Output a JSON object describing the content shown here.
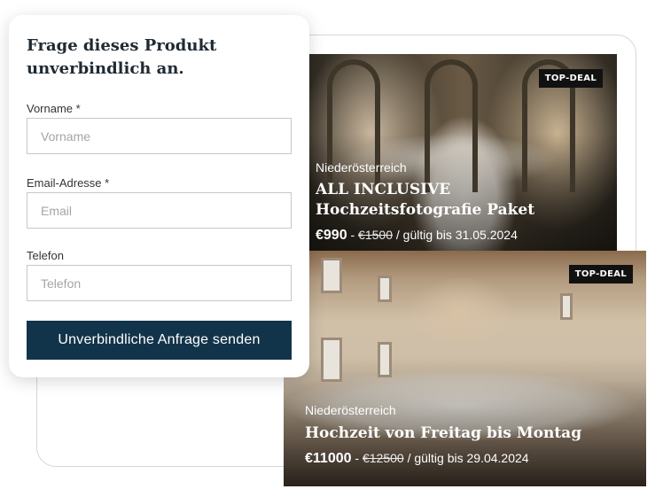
{
  "form": {
    "title": "Frage dieses Produkt unverbindlich an.",
    "fields": [
      {
        "label": "Vorname *",
        "placeholder": "Vorname",
        "value": ""
      },
      {
        "label": "Email-Adresse *",
        "placeholder": "Email",
        "value": ""
      },
      {
        "label": "Telefon",
        "placeholder": "Telefon",
        "value": ""
      }
    ],
    "submit_label": "Unverbindliche Anfrage senden"
  },
  "deals": [
    {
      "badge": "TOP-DEAL",
      "region": "Niederösterreich",
      "title": "ALL INCLUSIVE Hochzeitsfotografie Paket",
      "price": "€990",
      "separator": "-",
      "old_price": "€1500",
      "validity": "/ gültig bis 31.05.2024"
    },
    {
      "badge": "TOP-DEAL",
      "region": "Niederösterreich",
      "title": "Hochzeit von Freitag bis Montag",
      "price": "€11000",
      "separator": "-",
      "old_price": "€12500",
      "validity": "/ gültig bis 29.04.2024"
    }
  ],
  "colors": {
    "button": "#12344a",
    "badge": "#111111",
    "title_text": "#1f2a33"
  }
}
